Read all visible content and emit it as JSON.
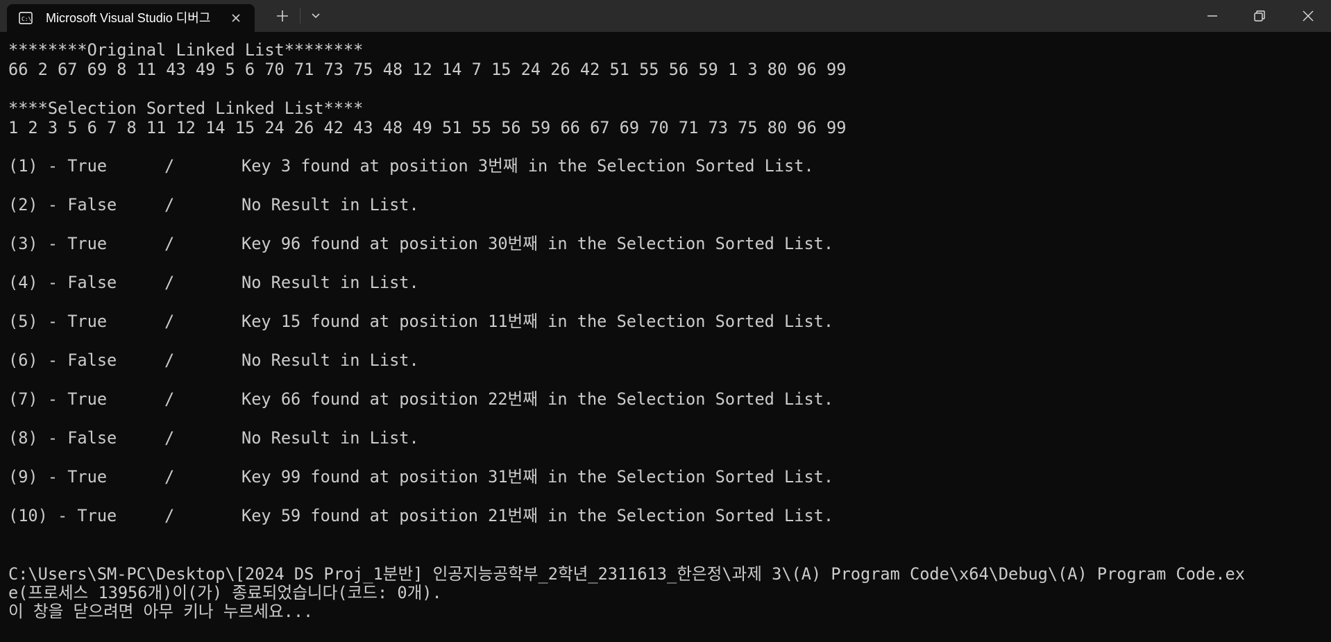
{
  "window": {
    "tab_title": "Microsoft Visual Studio 디버그",
    "icons": {
      "tab": "console-icon",
      "close_tab": "close-icon",
      "new_tab": "plus-icon",
      "dropdown": "chevron-down-icon",
      "minimize": "minimize-icon",
      "restore": "restore-icon",
      "close": "close-icon"
    },
    "colors": {
      "titlebar": "#2b2b2b",
      "background": "#0c0c0c",
      "text": "#cccccc"
    }
  },
  "console": {
    "original_header": "********Original Linked List********",
    "original_values": "66 2 67 69 8 11 43 49 5 6 70 71 73 75 48 12 14 7 15 24 26 42 51 55 56 59 1 3 80 96 99",
    "sorted_header": "****Selection Sorted Linked List****",
    "sorted_values": "1 2 3 5 6 7 8 11 12 14 15 24 26 42 43 48 49 51 55 56 59 66 67 69 70 71 73 75 80 96 99",
    "results": [
      {
        "label": "(1) - True",
        "slash": "/",
        "message": "Key 3 found at position 3번째 in the Selection Sorted List."
      },
      {
        "label": "(2) - False",
        "slash": "/",
        "message": "No Result in List."
      },
      {
        "label": "(3) - True",
        "slash": "/",
        "message": "Key 96 found at position 30번째 in the Selection Sorted List."
      },
      {
        "label": "(4) - False",
        "slash": "/",
        "message": "No Result in List."
      },
      {
        "label": "(5) - True",
        "slash": "/",
        "message": "Key 15 found at position 11번째 in the Selection Sorted List."
      },
      {
        "label": "(6) - False",
        "slash": "/",
        "message": "No Result in List."
      },
      {
        "label": "(7) - True",
        "slash": "/",
        "message": "Key 66 found at position 22번째 in the Selection Sorted List."
      },
      {
        "label": "(8) - False",
        "slash": "/",
        "message": "No Result in List."
      },
      {
        "label": "(9) - True",
        "slash": "/",
        "message": "Key 99 found at position 31번째 in the Selection Sorted List."
      },
      {
        "label": "(10) - True",
        "slash": "/",
        "message": "Key 59 found at position 21번째 in the Selection Sorted List."
      }
    ],
    "exit_line_1": "C:\\Users\\SM-PC\\Desktop\\[2024 DS Proj_1분반] 인공지능공학부_2학년_2311613_한은정\\과제 3\\(A) Program Code\\x64\\Debug\\(A) Program Code.ex",
    "exit_line_2": "e(프로세스 13956개)이(가) 종료되었습니다(코드: 0개).",
    "exit_line_3": "이 창을 닫으려면 아무 키나 누르세요..."
  }
}
